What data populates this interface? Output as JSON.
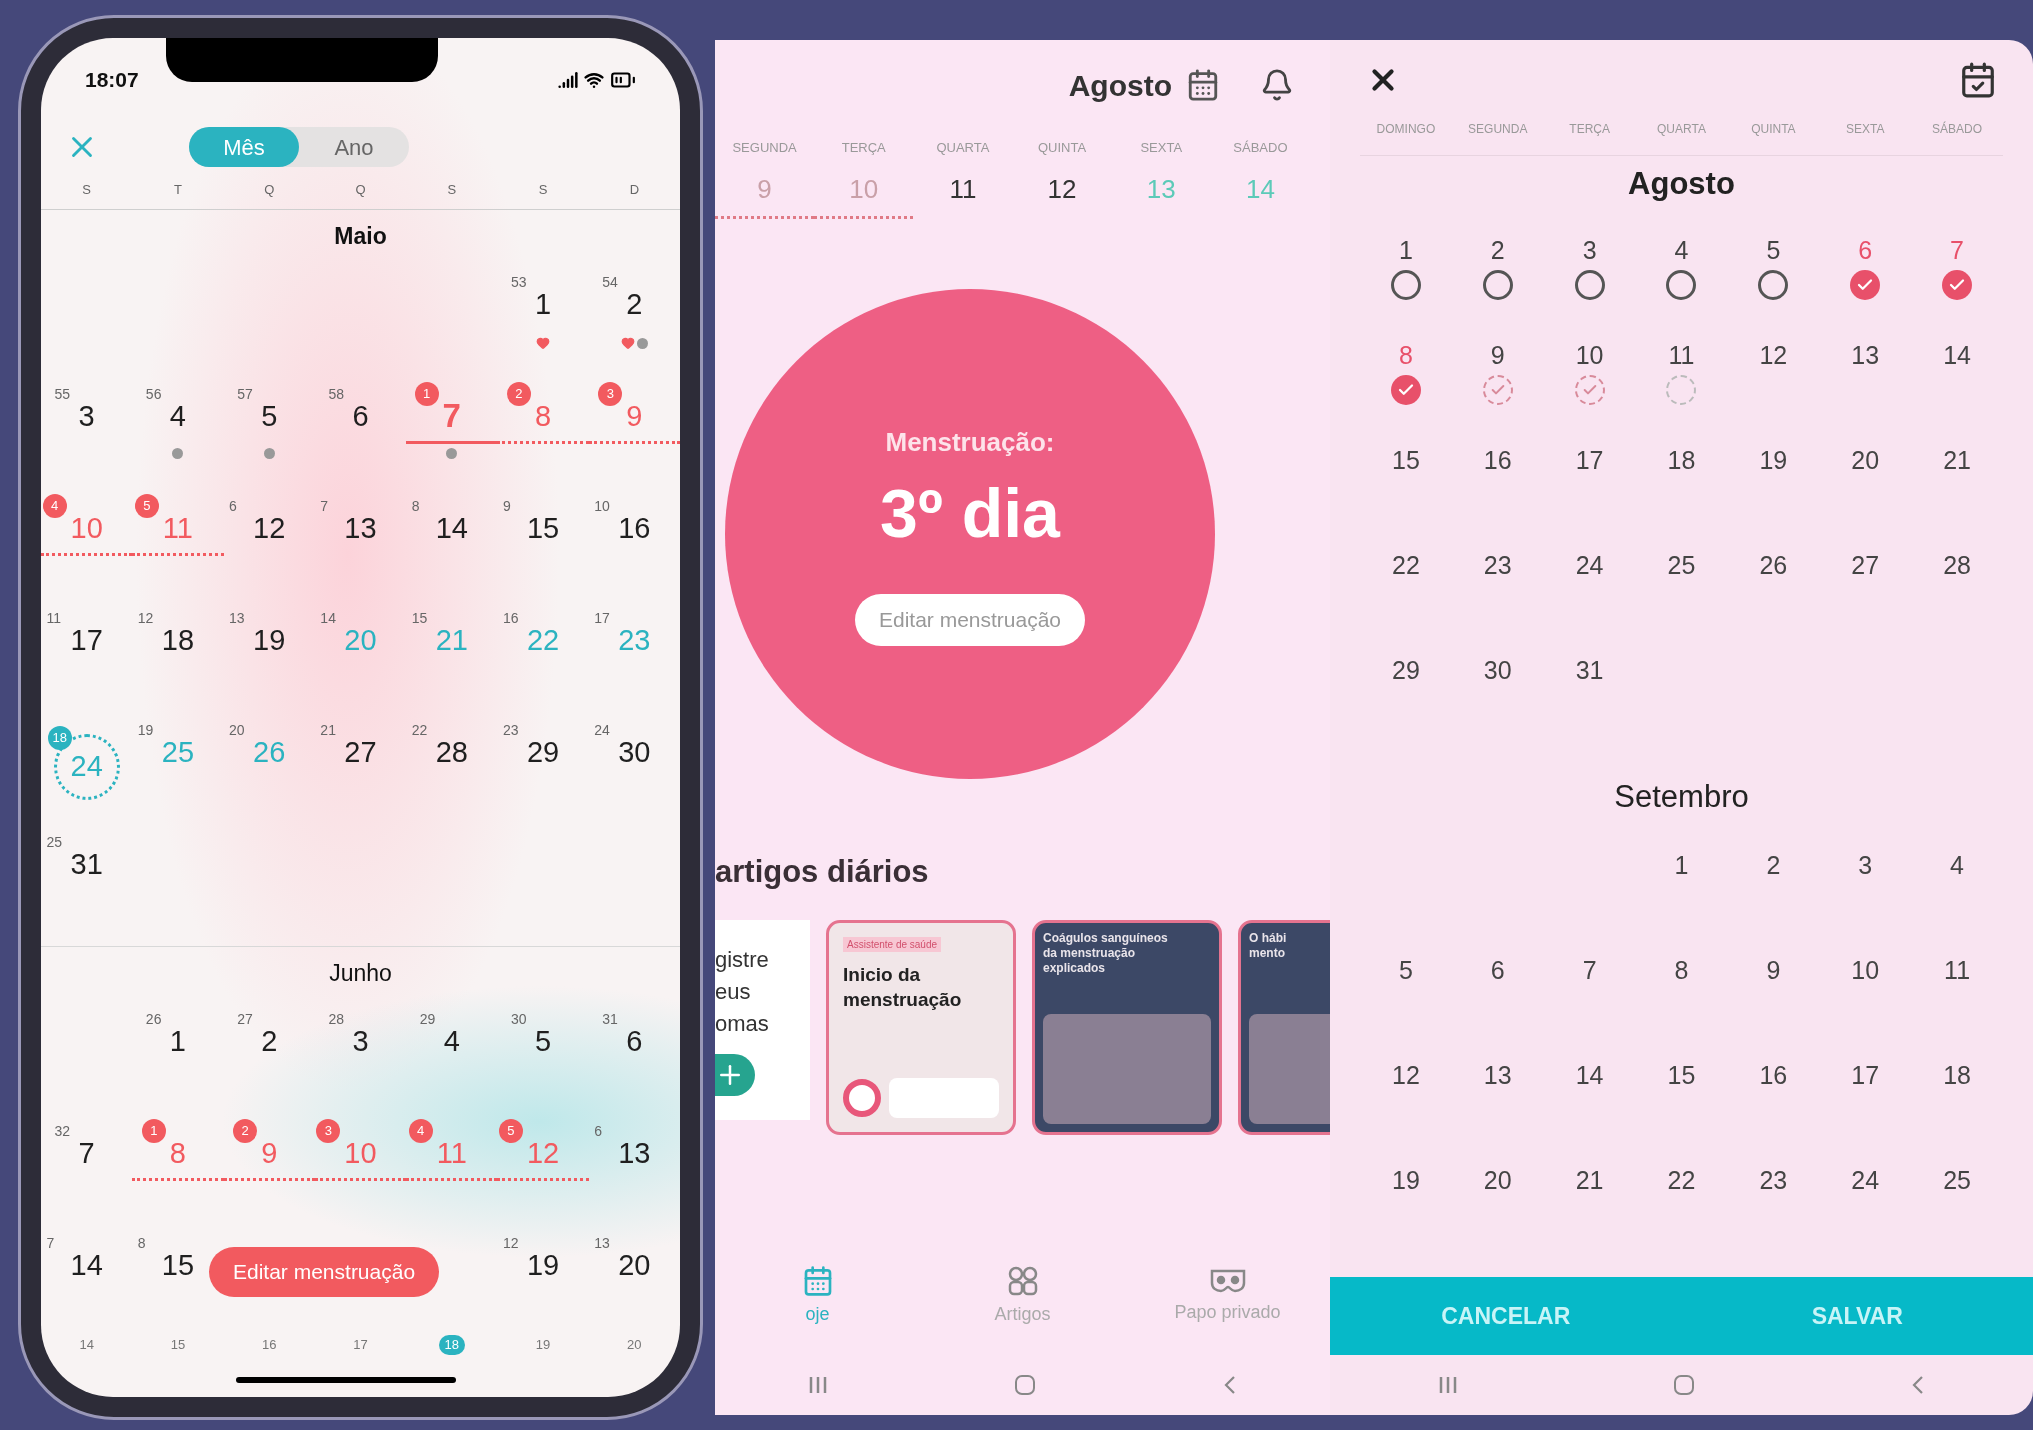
{
  "left_phone": {
    "status_bar": {
      "time": "18:07"
    },
    "view_toggle": [
      {
        "label": "Mês",
        "selected": true
      },
      {
        "label": "Ano",
        "selected": false
      }
    ],
    "weekdays": [
      "S",
      "T",
      "Q",
      "Q",
      "S",
      "S",
      "D"
    ],
    "months": [
      {
        "name": "Maio",
        "current": true,
        "weeks": [
          [
            {
              "kind": "blank"
            },
            {
              "kind": "blank"
            },
            {
              "kind": "blank"
            },
            {
              "kind": "blank"
            },
            {
              "kind": "blank"
            },
            {
              "day": "1",
              "cycle_day": "53",
              "kind": "plain",
              "marks": [
                {
                  "kind": "heart"
                }
              ]
            },
            {
              "day": "2",
              "cycle_day": "54",
              "kind": "plain",
              "marks": [
                {
                  "kind": "heart"
                },
                {
                  "kind": "dot"
                }
              ]
            }
          ],
          [
            {
              "day": "3",
              "cycle_day": "55",
              "kind": "plain"
            },
            {
              "day": "4",
              "cycle_day": "56",
              "kind": "plain",
              "marks": [
                {
                  "kind": "dot"
                }
              ]
            },
            {
              "day": "5",
              "cycle_day": "57",
              "kind": "plain",
              "marks": [
                {
                  "kind": "dot"
                }
              ]
            },
            {
              "day": "6",
              "cycle_day": "58",
              "kind": "plain"
            },
            {
              "day": "7",
              "badge": "1",
              "kind": "period",
              "underline": {
                "kind": "solid"
              },
              "marks": [
                {
                  "kind": "dot"
                }
              ]
            },
            {
              "day": "8",
              "badge": "2",
              "kind": "period",
              "underline": {
                "kind": "dotted"
              }
            },
            {
              "day": "9",
              "badge": "3",
              "kind": "period",
              "underline": {
                "kind": "dotted"
              }
            }
          ],
          [
            {
              "day": "10",
              "badge": "4",
              "kind": "period",
              "underline": {
                "kind": "dotted"
              }
            },
            {
              "day": "11",
              "badge": "5",
              "kind": "period",
              "underline": {
                "kind": "dotted"
              }
            },
            {
              "day": "12",
              "cycle_day": "6",
              "kind": "plain"
            },
            {
              "day": "13",
              "cycle_day": "7",
              "kind": "plain"
            },
            {
              "day": "14",
              "cycle_day": "8",
              "kind": "plain"
            },
            {
              "day": "15",
              "cycle_day": "9",
              "kind": "plain"
            },
            {
              "day": "16",
              "cycle_day": "10",
              "kind": "plain"
            }
          ],
          [
            {
              "day": "17",
              "cycle_day": "11",
              "kind": "plain"
            },
            {
              "day": "18",
              "cycle_day": "12",
              "kind": "plain"
            },
            {
              "day": "19",
              "cycle_day": "13",
              "kind": "plain"
            },
            {
              "day": "20",
              "cycle_day": "14",
              "kind": "fertile"
            },
            {
              "day": "21",
              "cycle_day": "15",
              "kind": "fertile"
            },
            {
              "day": "22",
              "cycle_day": "16",
              "kind": "fertile"
            },
            {
              "day": "23",
              "cycle_day": "17",
              "kind": "fertile"
            }
          ],
          [
            {
              "day": "24",
              "badge": "18",
              "kind": "ovulation"
            },
            {
              "day": "25",
              "cycle_day": "19",
              "kind": "fertile"
            },
            {
              "day": "26",
              "cycle_day": "20",
              "kind": "fertile"
            },
            {
              "day": "27",
              "cycle_day": "21",
              "kind": "plain"
            },
            {
              "day": "28",
              "cycle_day": "22",
              "kind": "plain"
            },
            {
              "day": "29",
              "cycle_day": "23",
              "kind": "plain"
            },
            {
              "day": "30",
              "cycle_day": "24",
              "kind": "plain"
            }
          ],
          [
            {
              "day": "31",
              "cycle_day": "25",
              "kind": "plain"
            },
            {
              "kind": "blank"
            },
            {
              "kind": "blank"
            },
            {
              "kind": "blank"
            },
            {
              "kind": "blank"
            },
            {
              "kind": "blank"
            },
            {
              "kind": "blank"
            }
          ]
        ]
      },
      {
        "name": "Junho",
        "current": false,
        "weeks": [
          [
            {
              "kind": "blank"
            },
            {
              "day": "1",
              "cycle_day": "26",
              "kind": "plain"
            },
            {
              "day": "2",
              "cycle_day": "27",
              "kind": "plain"
            },
            {
              "day": "3",
              "cycle_day": "28",
              "kind": "plain"
            },
            {
              "day": "4",
              "cycle_day": "29",
              "kind": "plain"
            },
            {
              "day": "5",
              "cycle_day": "30",
              "kind": "plain"
            },
            {
              "day": "6",
              "cycle_day": "31",
              "kind": "plain"
            }
          ],
          [
            {
              "day": "7",
              "cycle_day": "32",
              "kind": "plain"
            },
            {
              "day": "8",
              "badge": "1",
              "kind": "period",
              "underline": {
                "kind": "dotted"
              }
            },
            {
              "day": "9",
              "badge": "2",
              "kind": "period",
              "underline": {
                "kind": "dotted"
              }
            },
            {
              "day": "10",
              "badge": "3",
              "kind": "period",
              "underline": {
                "kind": "dotted"
              }
            },
            {
              "day": "11",
              "badge": "4",
              "kind": "period",
              "underline": {
                "kind": "dotted"
              }
            },
            {
              "day": "12",
              "badge": "5",
              "kind": "period",
              "underline": {
                "kind": "dotted"
              }
            },
            {
              "day": "13",
              "cycle_day": "6",
              "kind": "plain"
            }
          ],
          [
            {
              "day": "14",
              "cycle_day": "7",
              "kind": "plain"
            },
            {
              "day": "15",
              "cycle_day": "8",
              "kind": "plain"
            },
            {
              "kind": "blank"
            },
            {
              "kind": "blank"
            },
            {
              "kind": "blank"
            },
            {
              "day": "19",
              "cycle_day": "12",
              "kind": "plain"
            },
            {
              "day": "20",
              "cycle_day": "13",
              "kind": "plain"
            }
          ]
        ]
      }
    ],
    "edit_button": "Editar menstruação",
    "next_row_cycle_days": [
      {
        "text": "14",
        "kind": "plain"
      },
      {
        "text": "15",
        "kind": "plain"
      },
      {
        "text": "16",
        "kind": "plain"
      },
      {
        "text": "17",
        "kind": "plain"
      },
      {
        "text": "18",
        "kind": "ovulation"
      },
      {
        "text": "19",
        "kind": "plain"
      },
      {
        "text": "20",
        "kind": "plain"
      }
    ]
  },
  "middle_screen": {
    "header": {
      "month": "Agosto"
    },
    "week": [
      {
        "label": "SEGUNDA",
        "date": "9",
        "kind": "period"
      },
      {
        "label": "TERÇA",
        "date": "10",
        "kind": "period"
      },
      {
        "label": "QUARTA",
        "date": "11",
        "kind": "plain"
      },
      {
        "label": "QUINTA",
        "date": "12",
        "kind": "plain"
      },
      {
        "label": "SEXTA",
        "date": "13",
        "kind": "fertile"
      },
      {
        "label": "SÁBADO",
        "date": "14",
        "kind": "fertile"
      }
    ],
    "status": {
      "label": "Menstruação:",
      "value": "3º dia",
      "button": "Editar menstruação"
    },
    "articles": {
      "title": "artigos diários",
      "cards": [
        {
          "kind": "log",
          "lines": [
            "gistre",
            "eus",
            "omas"
          ]
        },
        {
          "kind": "article",
          "tag": "Assistente de saúde",
          "title": "Inicio da menstruação"
        },
        {
          "kind": "illustrated",
          "lines": [
            "Coágulos sanguíneos",
            "da menstruação",
            "explicados"
          ]
        },
        {
          "kind": "illustrated",
          "lines": [
            "O hábi",
            "mento"
          ]
        }
      ]
    },
    "tabs": [
      {
        "label": "oje",
        "kind": "today",
        "selected": true
      },
      {
        "label": "Artigos",
        "kind": "articles",
        "selected": false
      },
      {
        "label": "Papo privado",
        "kind": "chat",
        "selected": false
      }
    ]
  },
  "right_screen": {
    "weekdays": [
      "DOMINGO",
      "SEGUNDA",
      "TERÇA",
      "QUARTA",
      "QUINTA",
      "SEXTA",
      "SÁBADO"
    ],
    "months": [
      {
        "name": "Agosto",
        "weeks": [
          [
            {
              "day": "1",
              "kind": "open"
            },
            {
              "day": "2",
              "kind": "open"
            },
            {
              "day": "3",
              "kind": "open"
            },
            {
              "day": "4",
              "kind": "open"
            },
            {
              "day": "5",
              "kind": "open"
            },
            {
              "day": "6",
              "kind": "checked"
            },
            {
              "day": "7",
              "kind": "checked"
            }
          ],
          [
            {
              "day": "8",
              "kind": "checked"
            },
            {
              "day": "9",
              "kind": "forecast_checked"
            },
            {
              "day": "10",
              "kind": "forecast_checked"
            },
            {
              "day": "11",
              "kind": "forecast"
            },
            {
              "day": "12",
              "kind": "plain"
            },
            {
              "day": "13",
              "kind": "plain"
            },
            {
              "day": "14",
              "kind": "plain"
            }
          ],
          [
            {
              "day": "15",
              "kind": "plain"
            },
            {
              "day": "16",
              "kind": "plain"
            },
            {
              "day": "17",
              "kind": "plain"
            },
            {
              "day": "18",
              "kind": "plain"
            },
            {
              "day": "19",
              "kind": "plain"
            },
            {
              "day": "20",
              "kind": "plain"
            },
            {
              "day": "21",
              "kind": "plain"
            }
          ],
          [
            {
              "day": "22",
              "kind": "plain"
            },
            {
              "day": "23",
              "kind": "plain"
            },
            {
              "day": "24",
              "kind": "plain"
            },
            {
              "day": "25",
              "kind": "plain"
            },
            {
              "day": "26",
              "kind": "plain"
            },
            {
              "day": "27",
              "kind": "plain"
            },
            {
              "day": "28",
              "kind": "plain"
            }
          ],
          [
            {
              "day": "29",
              "kind": "plain"
            },
            {
              "day": "30",
              "kind": "plain"
            },
            {
              "day": "31",
              "kind": "plain"
            },
            {
              "kind": "blank"
            },
            {
              "kind": "blank"
            },
            {
              "kind": "blank"
            },
            {
              "kind": "blank"
            }
          ]
        ]
      },
      {
        "name": "Setembro",
        "weeks": [
          [
            {
              "kind": "blank"
            },
            {
              "kind": "blank"
            },
            {
              "kind": "blank"
            },
            {
              "day": "1",
              "kind": "plain"
            },
            {
              "day": "2",
              "kind": "plain"
            },
            {
              "day": "3",
              "kind": "plain"
            },
            {
              "day": "4",
              "kind": "plain"
            }
          ],
          [
            {
              "day": "5",
              "kind": "plain"
            },
            {
              "day": "6",
              "kind": "plain"
            },
            {
              "day": "7",
              "kind": "plain"
            },
            {
              "day": "8",
              "kind": "plain"
            },
            {
              "day": "9",
              "kind": "plain"
            },
            {
              "day": "10",
              "kind": "plain"
            },
            {
              "day": "11",
              "kind": "plain"
            }
          ],
          [
            {
              "day": "12",
              "kind": "plain"
            },
            {
              "day": "13",
              "kind": "plain"
            },
            {
              "day": "14",
              "kind": "plain"
            },
            {
              "day": "15",
              "kind": "plain"
            },
            {
              "day": "16",
              "kind": "plain"
            },
            {
              "day": "17",
              "kind": "plain"
            },
            {
              "day": "18",
              "kind": "plain"
            }
          ],
          [
            {
              "day": "19",
              "kind": "plain"
            },
            {
              "day": "20",
              "kind": "plain"
            },
            {
              "day": "21",
              "kind": "plain"
            },
            {
              "day": "22",
              "kind": "plain"
            },
            {
              "day": "23",
              "kind": "plain"
            },
            {
              "day": "24",
              "kind": "plain"
            },
            {
              "day": "25",
              "kind": "plain"
            }
          ]
        ]
      }
    ],
    "buttons": [
      {
        "label": "CANCELAR"
      },
      {
        "label": "SALVAR"
      }
    ]
  }
}
